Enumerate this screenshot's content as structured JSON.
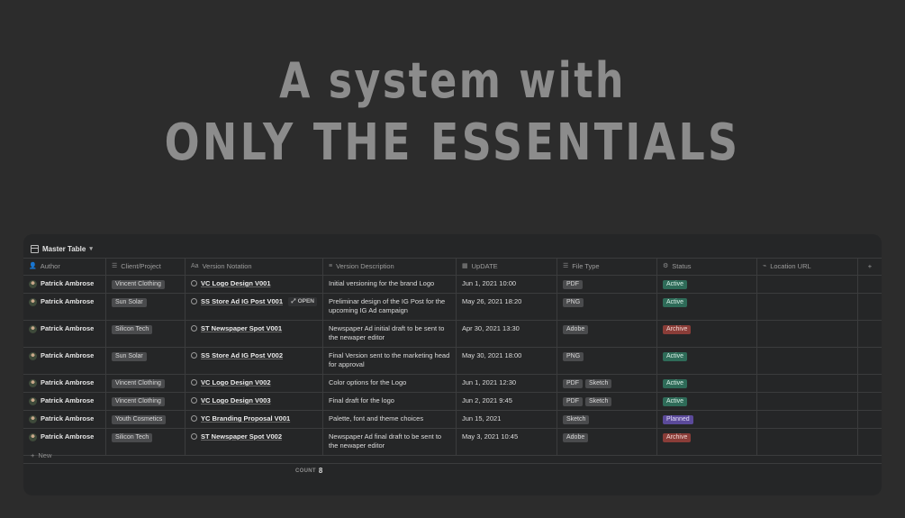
{
  "hero": {
    "line1": "A system with",
    "line2": "ONLY THE ESSENTIALS"
  },
  "view": {
    "name": "Master Table",
    "chevron": "▾"
  },
  "columns": [
    {
      "label": "Author",
      "icon": "person-icon",
      "glyph": "👤"
    },
    {
      "label": "Client/Project",
      "icon": "list-icon",
      "glyph": "☰"
    },
    {
      "label": "Version Notation",
      "icon": "text-icon",
      "glyph": "Aa"
    },
    {
      "label": "Version Description",
      "icon": "lines-icon",
      "glyph": "≡"
    },
    {
      "label": "UpDATE",
      "icon": "calendar-icon",
      "glyph": "▦"
    },
    {
      "label": "File Type",
      "icon": "multi-select-icon",
      "glyph": "☰"
    },
    {
      "label": "Status",
      "icon": "status-icon",
      "glyph": "⚙"
    },
    {
      "label": "Location URL",
      "icon": "link-icon",
      "glyph": "⌁"
    }
  ],
  "add_column_label": "+",
  "rows": [
    {
      "author": "Patrick Ambrose",
      "client": "Vincent Clothing",
      "version": "VC Logo Design V001",
      "desc": "Initial versioning for the brand Logo",
      "date": "Jun 1, 2021 10:00",
      "files": [
        "PDF"
      ],
      "status": "Active",
      "status_color": "green",
      "url": ""
    },
    {
      "author": "Patrick Ambrose",
      "client": "Sun Solar",
      "version": "SS Store Ad IG Post V001",
      "desc": "Preliminar design of the IG Post for the upcoming IG Ad campaign",
      "date": "May 26, 2021 18:20",
      "files": [
        "PNG"
      ],
      "status": "Active",
      "status_color": "green",
      "url": "",
      "open": "OPEN"
    },
    {
      "author": "Patrick Ambrose",
      "client": "Silicon Tech",
      "version": "ST Newspaper Spot V001",
      "desc": "Newspaper Ad initial draft to be sent to the newaper editor",
      "date": "Apr 30, 2021 13:30",
      "files": [
        "Adobe"
      ],
      "status": "Archive",
      "status_color": "red",
      "url": ""
    },
    {
      "author": "Patrick Ambrose",
      "client": "Sun Solar",
      "version": "SS Store Ad IG Post V002",
      "desc": "Final Version sent to the marketing head for approval",
      "date": "May 30, 2021 18:00",
      "files": [
        "PNG"
      ],
      "status": "Active",
      "status_color": "green",
      "url": ""
    },
    {
      "author": "Patrick Ambrose",
      "client": "Vincent Clothing",
      "version": "VC Logo Design V002",
      "desc": "Color options for the Logo",
      "date": "Jun 1, 2021 12:30",
      "files": [
        "PDF",
        "Sketch"
      ],
      "status": "Active",
      "status_color": "green",
      "url": ""
    },
    {
      "author": "Patrick Ambrose",
      "client": "Vincent Clothing",
      "version": "VC Logo Design V003",
      "desc": "Final draft for the logo",
      "date": "Jun 2, 2021 9:45",
      "files": [
        "PDF",
        "Sketch"
      ],
      "status": "Active",
      "status_color": "green",
      "url": ""
    },
    {
      "author": "Patrick Ambrose",
      "client": "Youth Cosmetics",
      "version": "YC Branding Proposal V001",
      "desc": "Palette, font and theme choices",
      "date": "Jun 15, 2021",
      "files": [
        "Sketch"
      ],
      "status": "Planned",
      "status_color": "purple",
      "url": ""
    },
    {
      "author": "Patrick Ambrose",
      "client": "Silicon Tech",
      "version": "ST Newspaper Spot V002",
      "desc": "Newspaper Ad final draft to be sent to the newaper editor",
      "date": "May 3, 2021 10:45",
      "files": [
        "Adobe"
      ],
      "status": "Archive",
      "status_color": "red",
      "url": ""
    }
  ],
  "row_heights": "layout-independent",
  "new_label": "New",
  "count": {
    "label": "COUNT",
    "value": "8"
  }
}
